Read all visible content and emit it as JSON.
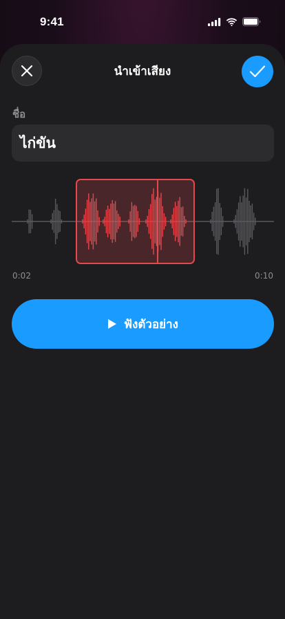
{
  "status_bar": {
    "time": "9:41"
  },
  "header": {
    "title": "นำเข้าเสียง",
    "close_icon": "close-icon",
    "confirm_icon": "checkmark-icon"
  },
  "form": {
    "name_label": "ชื่อ",
    "name_value": "ไก่ขัน"
  },
  "trimmer": {
    "start_time": "0:02",
    "end_time": "0:10",
    "selection_color": "#e5484d",
    "unselected_color": "#5a5a5e",
    "playhead_icon": "playhead-icon"
  },
  "actions": {
    "preview_label": "ฟังตัวอย่าง",
    "preview_icon": "play-icon"
  },
  "colors": {
    "accent": "#1a9bff",
    "sheet_bg": "#1d1d1f",
    "field_bg": "#2c2c2e"
  }
}
